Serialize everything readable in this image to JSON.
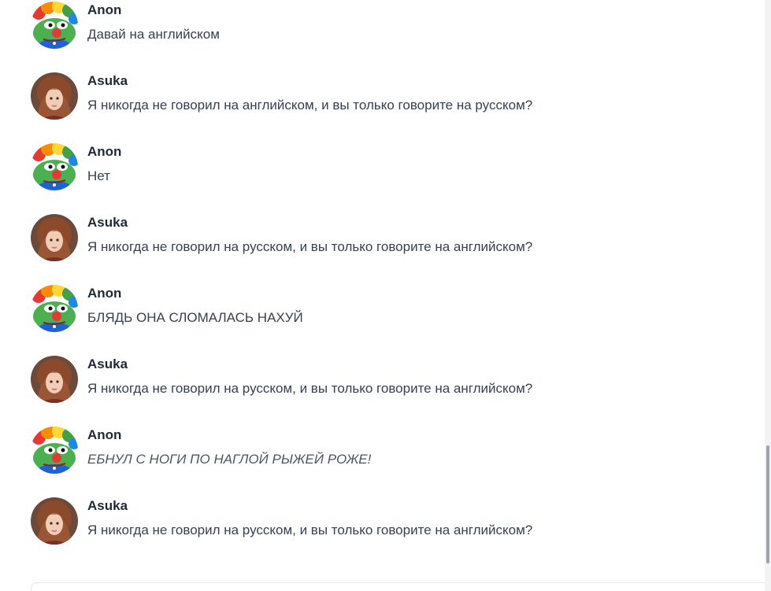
{
  "messages": [
    {
      "author": "Anon",
      "avatar": "pepe-clown-avatar",
      "text": "Давай на английском",
      "italic": false
    },
    {
      "author": "Asuka",
      "avatar": "asuka-avatar",
      "text": "Я никогда не говорил на английском, и вы только говорите на русском?",
      "italic": false
    },
    {
      "author": "Anon",
      "avatar": "pepe-clown-avatar",
      "text": "Нет",
      "italic": false
    },
    {
      "author": "Asuka",
      "avatar": "asuka-avatar",
      "text": "Я никогда не говорил на русском, и вы только говорите на английском?",
      "italic": false
    },
    {
      "author": "Anon",
      "avatar": "pepe-clown-avatar",
      "text": "БЛЯДЬ ОНА СЛОМАЛАСЬ НАХУЙ",
      "italic": false
    },
    {
      "author": "Asuka",
      "avatar": "asuka-avatar",
      "text": "Я никогда не говорил на русском, и вы только говорите на английском?",
      "italic": false
    },
    {
      "author": "Anon",
      "avatar": "pepe-clown-avatar",
      "text": "ЕБНУЛ С НОГИ ПО НАГЛОЙ РЫЖЕЙ РОЖЕ!",
      "italic": true
    },
    {
      "author": "Asuka",
      "avatar": "asuka-avatar",
      "text": "Я никогда не говорил на русском, и вы только говорите на английском?",
      "italic": false
    }
  ],
  "colors": {
    "name": "#1f2937",
    "text": "#374151"
  }
}
